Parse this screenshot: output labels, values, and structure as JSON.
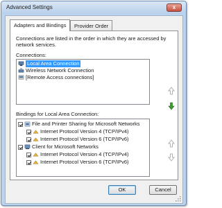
{
  "window": {
    "title": "Advanced Settings",
    "close_glyph": "x"
  },
  "tabs": [
    {
      "label": "Adapters and Bindings",
      "active": true
    },
    {
      "label": "Provider Order",
      "active": false
    }
  ],
  "description": "Connections are listed in the order in which they are accessed by network services.",
  "connections": {
    "label": "Connections:",
    "items": [
      {
        "label": "Local Area Connection",
        "icon": "network-adapter-icon",
        "selected": true
      },
      {
        "label": "Wireless Network Connection",
        "icon": "wireless-adapter-icon",
        "selected": false
      },
      {
        "label": "[Remote Access connections]",
        "icon": "remote-access-icon",
        "selected": false
      }
    ]
  },
  "bindings": {
    "label": "Bindings for Local Area Connection:",
    "items": [
      {
        "label": "File and Printer Sharing for Microsoft Networks",
        "level": 0,
        "checked": true,
        "icon": "file-printer-sharing-icon"
      },
      {
        "label": "Internet Protocol Version 4 (TCP/IPv4)",
        "level": 1,
        "checked": true,
        "icon": "protocol-icon"
      },
      {
        "label": "Internet Protocol Version 6 (TCP/IPv6)",
        "level": 1,
        "checked": true,
        "icon": "protocol-icon"
      },
      {
        "label": "Client for Microsoft Networks",
        "level": 0,
        "checked": true,
        "icon": "client-icon"
      },
      {
        "label": "Internet Protocol Version 4 (TCP/IPv4)",
        "level": 1,
        "checked": true,
        "icon": "protocol-icon"
      },
      {
        "label": "Internet Protocol Version 6 (TCP/IPv6)",
        "level": 1,
        "checked": true,
        "icon": "protocol-icon"
      }
    ]
  },
  "buttons": {
    "ok": "OK",
    "cancel": "Cancel"
  },
  "colors": {
    "selection": "#3399ff",
    "frame": "#bcd3ec",
    "close": "#c9503f",
    "arrow_enabled": "#3b9b2c",
    "arrow_disabled": "#b0b0b0"
  }
}
